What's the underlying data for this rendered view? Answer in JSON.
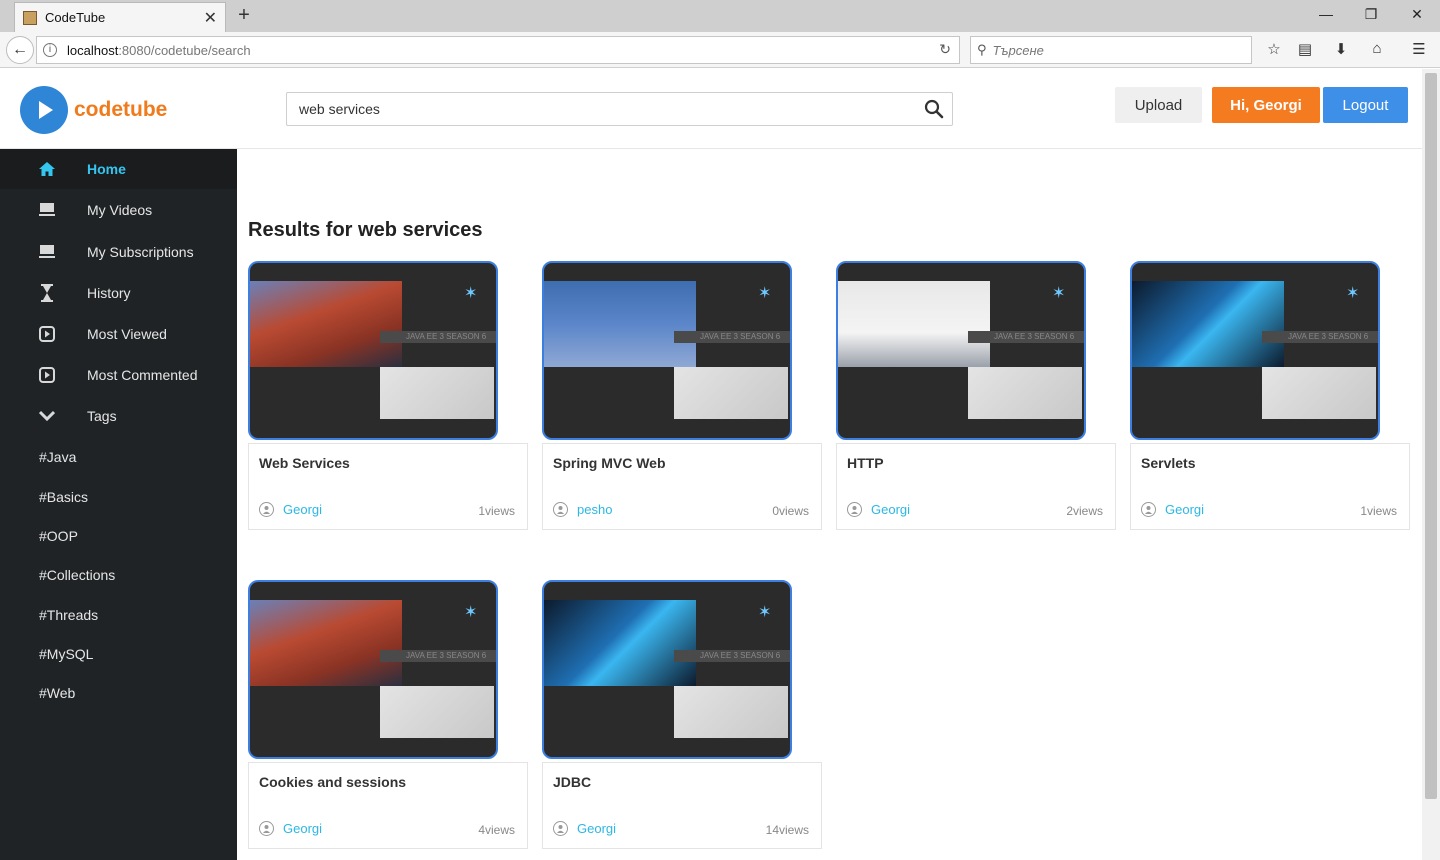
{
  "browser": {
    "tab_title": "CodeTube",
    "url_host": "localhost",
    "url_rest": ":8080/codetube/search",
    "search_placeholder": "Търсене"
  },
  "header": {
    "logo_text": "codetube",
    "search_value": "web services",
    "upload_label": "Upload",
    "greeting_label": "Hi, Georgi",
    "logout_label": "Logout"
  },
  "sidebar": {
    "items": [
      {
        "label": "Home",
        "icon": "home-icon"
      },
      {
        "label": "My Videos",
        "icon": "monitor-icon"
      },
      {
        "label": "My Subscriptions",
        "icon": "monitor-icon"
      },
      {
        "label": "History",
        "icon": "hourglass-icon"
      },
      {
        "label": "Most Viewed",
        "icon": "play-icon"
      },
      {
        "label": "Most Commented",
        "icon": "play-icon"
      },
      {
        "label": "Tags",
        "icon": "chevron-down-icon"
      }
    ],
    "tags": [
      "#Java",
      "#Basics",
      "#OOP",
      "#Collections",
      "#Threads",
      "#MySQL",
      "#Web"
    ]
  },
  "main": {
    "results_title": "Results for web services",
    "thumb_caption": "JAVA EE 3 SEASON 6",
    "videos": [
      {
        "title": "Web Services",
        "owner": "Georgi",
        "views": "1views"
      },
      {
        "title": "Spring MVC Web",
        "owner": "pesho",
        "views": "0views"
      },
      {
        "title": "HTTP",
        "owner": "Georgi",
        "views": "2views"
      },
      {
        "title": "Servlets",
        "owner": "Georgi",
        "views": "1views"
      },
      {
        "title": "Cookies and sessions",
        "owner": "Georgi",
        "views": "4views"
      },
      {
        "title": "JDBC",
        "owner": "Georgi",
        "views": "14views"
      }
    ]
  },
  "colors": {
    "accent_orange": "#f47b20",
    "accent_blue": "#3d8fe8",
    "link_cyan": "#2bb8e4",
    "sidebar_bg": "#1f2326"
  }
}
